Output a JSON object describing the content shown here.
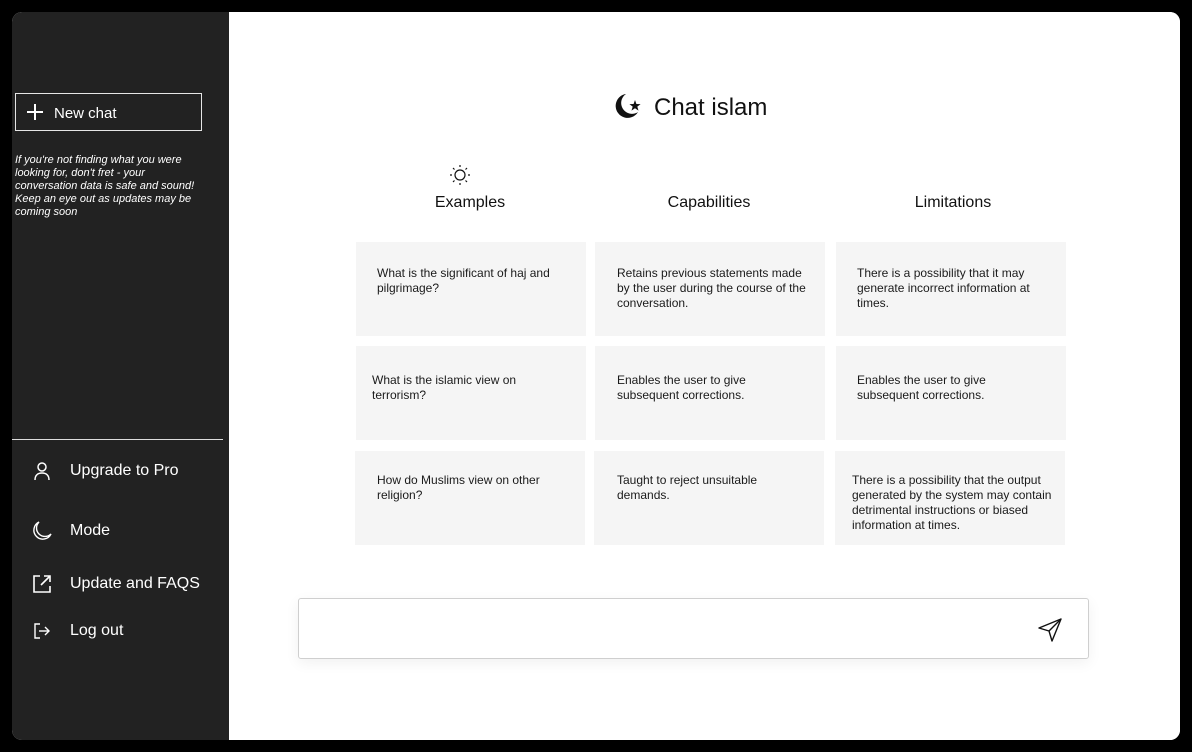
{
  "sidebar": {
    "new_chat_label": "New chat",
    "notice": "If you're not finding what you were looking for, don't fret - your conversation data is safe and sound! Keep an eye out as updates may be coming soon",
    "items": [
      {
        "label": "Upgrade to Pro",
        "icon": "user-icon"
      },
      {
        "label": "Mode",
        "icon": "moon-icon"
      },
      {
        "label": "Update and FAQS",
        "icon": "external-link-icon"
      },
      {
        "label": "Log out",
        "icon": "logout-icon"
      }
    ]
  },
  "header": {
    "title": "Chat islam",
    "logo_icon": "crescent-star-icon"
  },
  "columns": [
    {
      "heading": "Examples",
      "icon": "sun-icon",
      "cards": [
        "What is the significant of haj and pilgrimage?",
        "What is the islamic view on terrorism?",
        "How do Muslims view on other religion?"
      ]
    },
    {
      "heading": "Capabilities",
      "cards": [
        "Retains previous statements made by the user during the course of the conversation.",
        "Enables the user to give subsequent corrections.",
        "Taught to reject unsuitable demands."
      ]
    },
    {
      "heading": "Limitations",
      "cards": [
        "There is a possibility that it may generate incorrect information at times.",
        "Enables the user to give subsequent corrections.",
        "There is a possibility that the output generated by the system may contain detrimental instructions or biased information at times."
      ]
    }
  ],
  "composer": {
    "value": "",
    "send_icon": "send-icon"
  },
  "colors": {
    "sidebar_bg": "#222222",
    "card_bg": "#f5f5f5",
    "frame": "#000000"
  }
}
